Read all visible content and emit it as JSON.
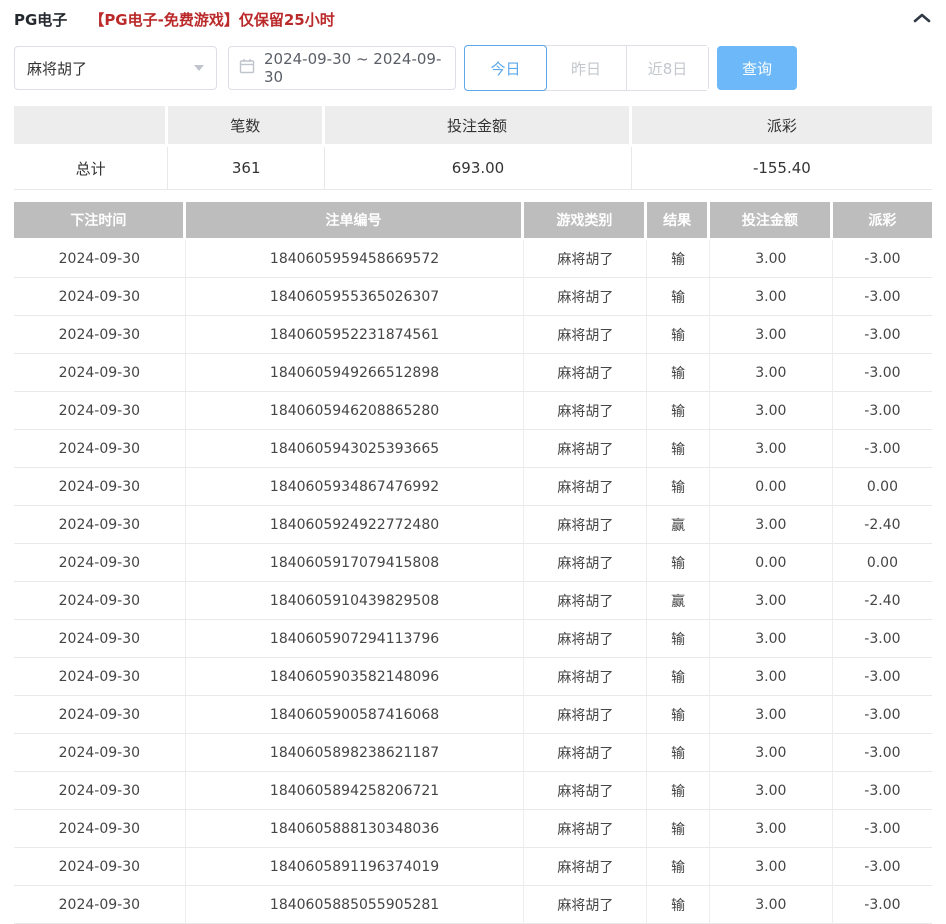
{
  "header": {
    "title": "PG电子",
    "notice": "【PG电子-免费游戏】仅保留25小时",
    "collapse_icon": "chevron-up-icon"
  },
  "filters": {
    "game_select": {
      "value": "麻将胡了",
      "icon": "chevron-down-icon"
    },
    "date_range": {
      "value": "2024-09-30 ~ 2024-09-30",
      "icon": "calendar-icon"
    },
    "quick_buttons": [
      {
        "label": "今日",
        "active": true
      },
      {
        "label": "昨日",
        "active": false
      },
      {
        "label": "近8日",
        "active": false
      }
    ],
    "query_label": "查询"
  },
  "summary": {
    "headers": [
      "",
      "笔数",
      "投注金额",
      "派彩"
    ],
    "row_label": "总计",
    "count": "361",
    "bet_amount": "693.00",
    "payout": "-155.40"
  },
  "table": {
    "headers": [
      "下注时间",
      "注单编号",
      "游戏类别",
      "结果",
      "投注金额",
      "派彩"
    ],
    "rows": [
      {
        "date": "2024-09-30",
        "bet_id": "1840605959458669572",
        "game": "麻将胡了",
        "result": "输",
        "amount": "3.00",
        "payout": "-3.00"
      },
      {
        "date": "2024-09-30",
        "bet_id": "1840605955365026307",
        "game": "麻将胡了",
        "result": "输",
        "amount": "3.00",
        "payout": "-3.00"
      },
      {
        "date": "2024-09-30",
        "bet_id": "1840605952231874561",
        "game": "麻将胡了",
        "result": "输",
        "amount": "3.00",
        "payout": "-3.00"
      },
      {
        "date": "2024-09-30",
        "bet_id": "1840605949266512898",
        "game": "麻将胡了",
        "result": "输",
        "amount": "3.00",
        "payout": "-3.00"
      },
      {
        "date": "2024-09-30",
        "bet_id": "1840605946208865280",
        "game": "麻将胡了",
        "result": "输",
        "amount": "3.00",
        "payout": "-3.00"
      },
      {
        "date": "2024-09-30",
        "bet_id": "1840605943025393665",
        "game": "麻将胡了",
        "result": "输",
        "amount": "3.00",
        "payout": "-3.00"
      },
      {
        "date": "2024-09-30",
        "bet_id": "1840605934867476992",
        "game": "麻将胡了",
        "result": "输",
        "amount": "0.00",
        "payout": "0.00"
      },
      {
        "date": "2024-09-30",
        "bet_id": "1840605924922772480",
        "game": "麻将胡了",
        "result": "赢",
        "amount": "3.00",
        "payout": "-2.40"
      },
      {
        "date": "2024-09-30",
        "bet_id": "1840605917079415808",
        "game": "麻将胡了",
        "result": "输",
        "amount": "0.00",
        "payout": "0.00"
      },
      {
        "date": "2024-09-30",
        "bet_id": "1840605910439829508",
        "game": "麻将胡了",
        "result": "赢",
        "amount": "3.00",
        "payout": "-2.40"
      },
      {
        "date": "2024-09-30",
        "bet_id": "1840605907294113796",
        "game": "麻将胡了",
        "result": "输",
        "amount": "3.00",
        "payout": "-3.00"
      },
      {
        "date": "2024-09-30",
        "bet_id": "1840605903582148096",
        "game": "麻将胡了",
        "result": "输",
        "amount": "3.00",
        "payout": "-3.00"
      },
      {
        "date": "2024-09-30",
        "bet_id": "1840605900587416068",
        "game": "麻将胡了",
        "result": "输",
        "amount": "3.00",
        "payout": "-3.00"
      },
      {
        "date": "2024-09-30",
        "bet_id": "1840605898238621187",
        "game": "麻将胡了",
        "result": "输",
        "amount": "3.00",
        "payout": "-3.00"
      },
      {
        "date": "2024-09-30",
        "bet_id": "1840605894258206721",
        "game": "麻将胡了",
        "result": "输",
        "amount": "3.00",
        "payout": "-3.00"
      },
      {
        "date": "2024-09-30",
        "bet_id": "1840605888130348036",
        "game": "麻将胡了",
        "result": "输",
        "amount": "3.00",
        "payout": "-3.00"
      },
      {
        "date": "2024-09-30",
        "bet_id": "1840605891196374019",
        "game": "麻将胡了",
        "result": "输",
        "amount": "3.00",
        "payout": "-3.00"
      },
      {
        "date": "2024-09-30",
        "bet_id": "1840605885055905281",
        "game": "麻将胡了",
        "result": "输",
        "amount": "3.00",
        "payout": "-3.00"
      }
    ]
  },
  "colors": {
    "accent": "#5ea9ea",
    "query_button": "#6cb8f8",
    "negative": "#f15c5c",
    "notice": "#bb2a2a",
    "table_header_bg": "#bdbdbd"
  }
}
